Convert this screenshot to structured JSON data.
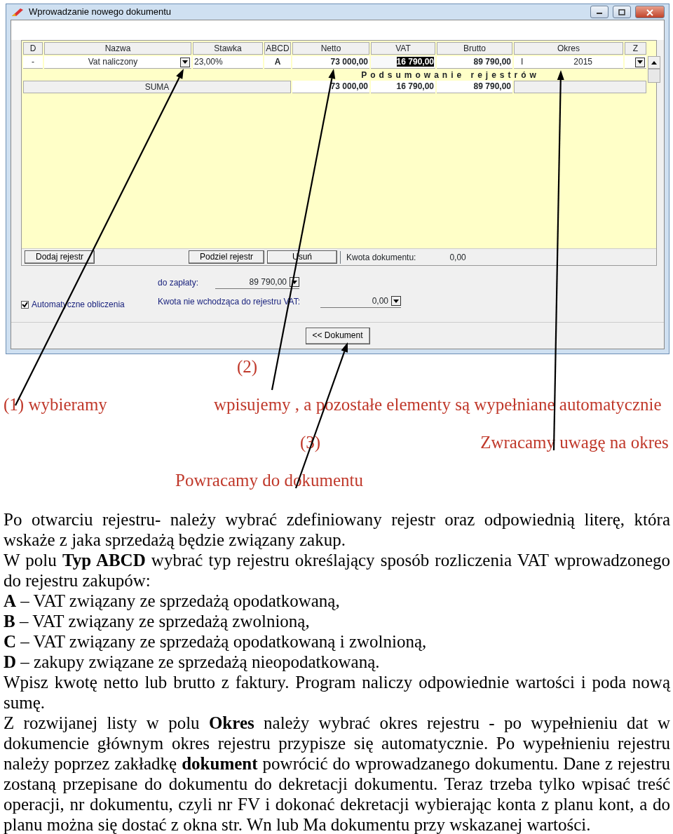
{
  "window": {
    "title": "Wprowadzanie nowego dokumentu"
  },
  "grid": {
    "columns": [
      "D",
      "Nazwa",
      "Stawka",
      "ABCD",
      "Netto",
      "VAT",
      "Brutto",
      "Okres",
      "Z"
    ],
    "row": {
      "cells": [
        {
          "text": "-",
          "selected": false
        },
        {
          "text": "Vat naliczony",
          "selected": false
        },
        {
          "text": "23,00%",
          "selected": false
        },
        {
          "text": "A",
          "selected": false
        },
        {
          "text": "73 000,00",
          "selected": false
        },
        {
          "text": "16 790,00",
          "selected": true
        },
        {
          "text": "89 790,00",
          "selected": false
        }
      ],
      "period": {
        "month": "I",
        "year": "2015"
      }
    },
    "summary": {
      "title": "Podsumowanie rejestrów",
      "label": "SUMA",
      "netto": "73 000,00",
      "vat": "16 790,00",
      "brutto": "89 790,00"
    }
  },
  "buttons": [
    "Dodaj rejestr",
    "Podziel rejestr",
    "Usuń"
  ],
  "document_amount": {
    "label": "Kwota dokumentu:",
    "value": "0,00"
  },
  "payment": {
    "label": "do zapłaty:",
    "value": "89 790,00"
  },
  "auto_calc": {
    "label": "Automatyczne obliczenia",
    "checked": true
  },
  "non_vat": {
    "label": "Kwota nie wchodząca do rejestru VAT:",
    "value": "0,00"
  },
  "back_button": "<< Dokument",
  "annotations": [
    [
      "(2)"
    ],
    [
      "(1) wybieramy",
      "wpisujemy , a pozostałe elementy są wypełniane automatycznie"
    ],
    [
      "(3)",
      "Zwracamy uwagę na okres"
    ],
    [
      "Powracamy do dokumentu"
    ]
  ],
  "paragraphs": [
    "Po otwarciu rejestru- należy wybrać zdefiniowany rejestr oraz odpowiednią literę, która wskaże z jaka sprzedażą będzie związany zakup.",
    "W polu **Typ ABCD** wybrać typ rejestru określający sposób rozliczenia VAT wprowadzonego do rejestru zakupów:",
    "**A** – VAT związany ze sprzedażą opodatkowaną,",
    "**B** – VAT związany ze sprzedażą zwolnioną,",
    "**C** – VAT związany ze sprzedażą opodatkowaną i zwolnioną,",
    "**D** – zakupy związane ze sprzedażą nieopodatkowaną.",
    "Wpisz kwotę netto lub brutto z faktury. Program naliczy odpowiednie wartości i poda nową sumę.",
    "Z rozwijanej listy w polu **Okres** należy wybrać okres rejestru - po wypełnieniu dat w dokumencie głównym okres rejestru przypisze się automatycznie. Po wypełnieniu rejestru należy poprzez zakładkę **dokument** powrócić do wprowadzanego dokumentu. Dane z rejestru zostaną przepisane do dokumentu do dekretacji dokumentu. Teraz trzeba tylko wpisać treść operacji, nr dokumentu, czyli nr FV i dokonać dekretacji wybierając konta z planu kont, a do planu można się dostać  z okna  str. Wn lub Ma dokumentu przy wskazanej wartości."
  ]
}
